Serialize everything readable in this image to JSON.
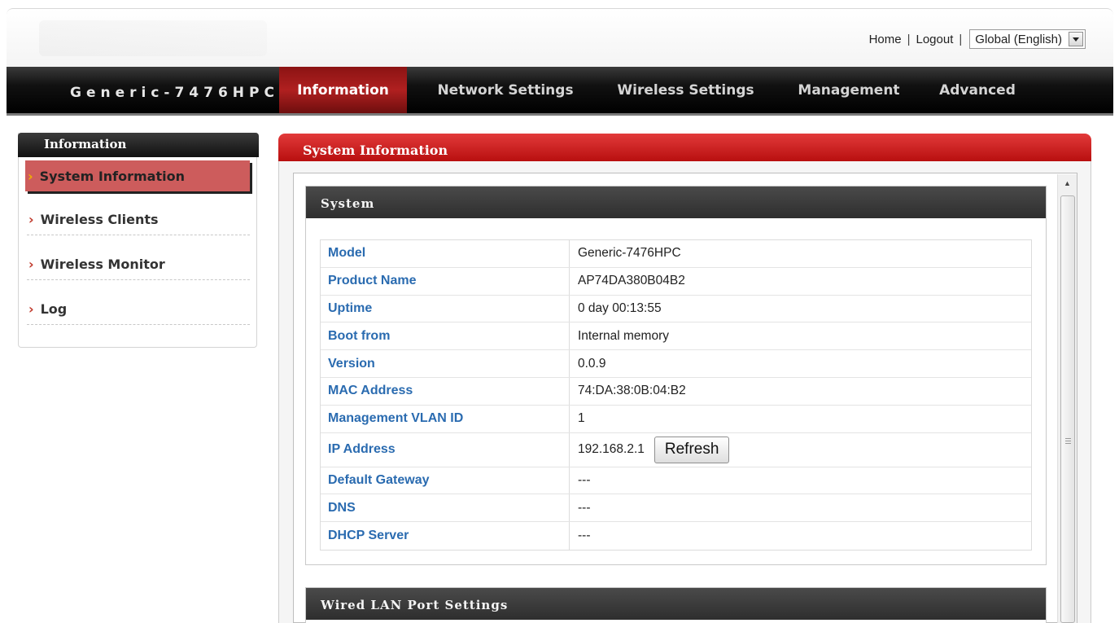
{
  "header": {
    "links": {
      "home": "Home",
      "logout": "Logout",
      "sep": "|"
    },
    "language": {
      "selected": "Global (English)"
    }
  },
  "nav": {
    "brand": "Generic-7476HPC",
    "tabs": [
      {
        "label": "Information",
        "active": true
      },
      {
        "label": "Network Settings"
      },
      {
        "label": "Wireless Settings"
      },
      {
        "label": "Management"
      },
      {
        "label": "Advanced"
      }
    ]
  },
  "sidebar": {
    "title": "Information",
    "items": [
      {
        "label": "System Information",
        "active": true
      },
      {
        "label": "Wireless Clients"
      },
      {
        "label": "Wireless Monitor"
      },
      {
        "label": "Log"
      }
    ]
  },
  "main": {
    "title": "System Information",
    "system": {
      "heading": "System",
      "rows": [
        {
          "label": "Model",
          "value": "Generic-7476HPC"
        },
        {
          "label": "Product Name",
          "value": "AP74DA380B04B2"
        },
        {
          "label": "Uptime",
          "value": " 0 day 00:13:55"
        },
        {
          "label": "Boot from",
          "value": "Internal memory"
        },
        {
          "label": "Version",
          "value": "0.0.9"
        },
        {
          "label": "MAC Address",
          "value": "74:DA:38:0B:04:B2"
        },
        {
          "label": "Management VLAN ID",
          "value": "1"
        },
        {
          "label": "IP Address",
          "value": "192.168.2.1"
        },
        {
          "label": "Default Gateway",
          "value": "---"
        },
        {
          "label": "DNS",
          "value": "---"
        },
        {
          "label": "DHCP Server",
          "value": "---"
        }
      ],
      "refresh_label": "Refresh"
    },
    "wired": {
      "heading": "Wired LAN Port Settings"
    }
  },
  "colors": {
    "accent_red": "#b80f0f",
    "label_blue": "#2a6bb0",
    "nav_black": "#000000"
  },
  "icons": {
    "chevron": "chevron-right-icon",
    "dropdown": "chevron-down-icon",
    "scroll_up": "scroll-up-arrow-icon"
  }
}
